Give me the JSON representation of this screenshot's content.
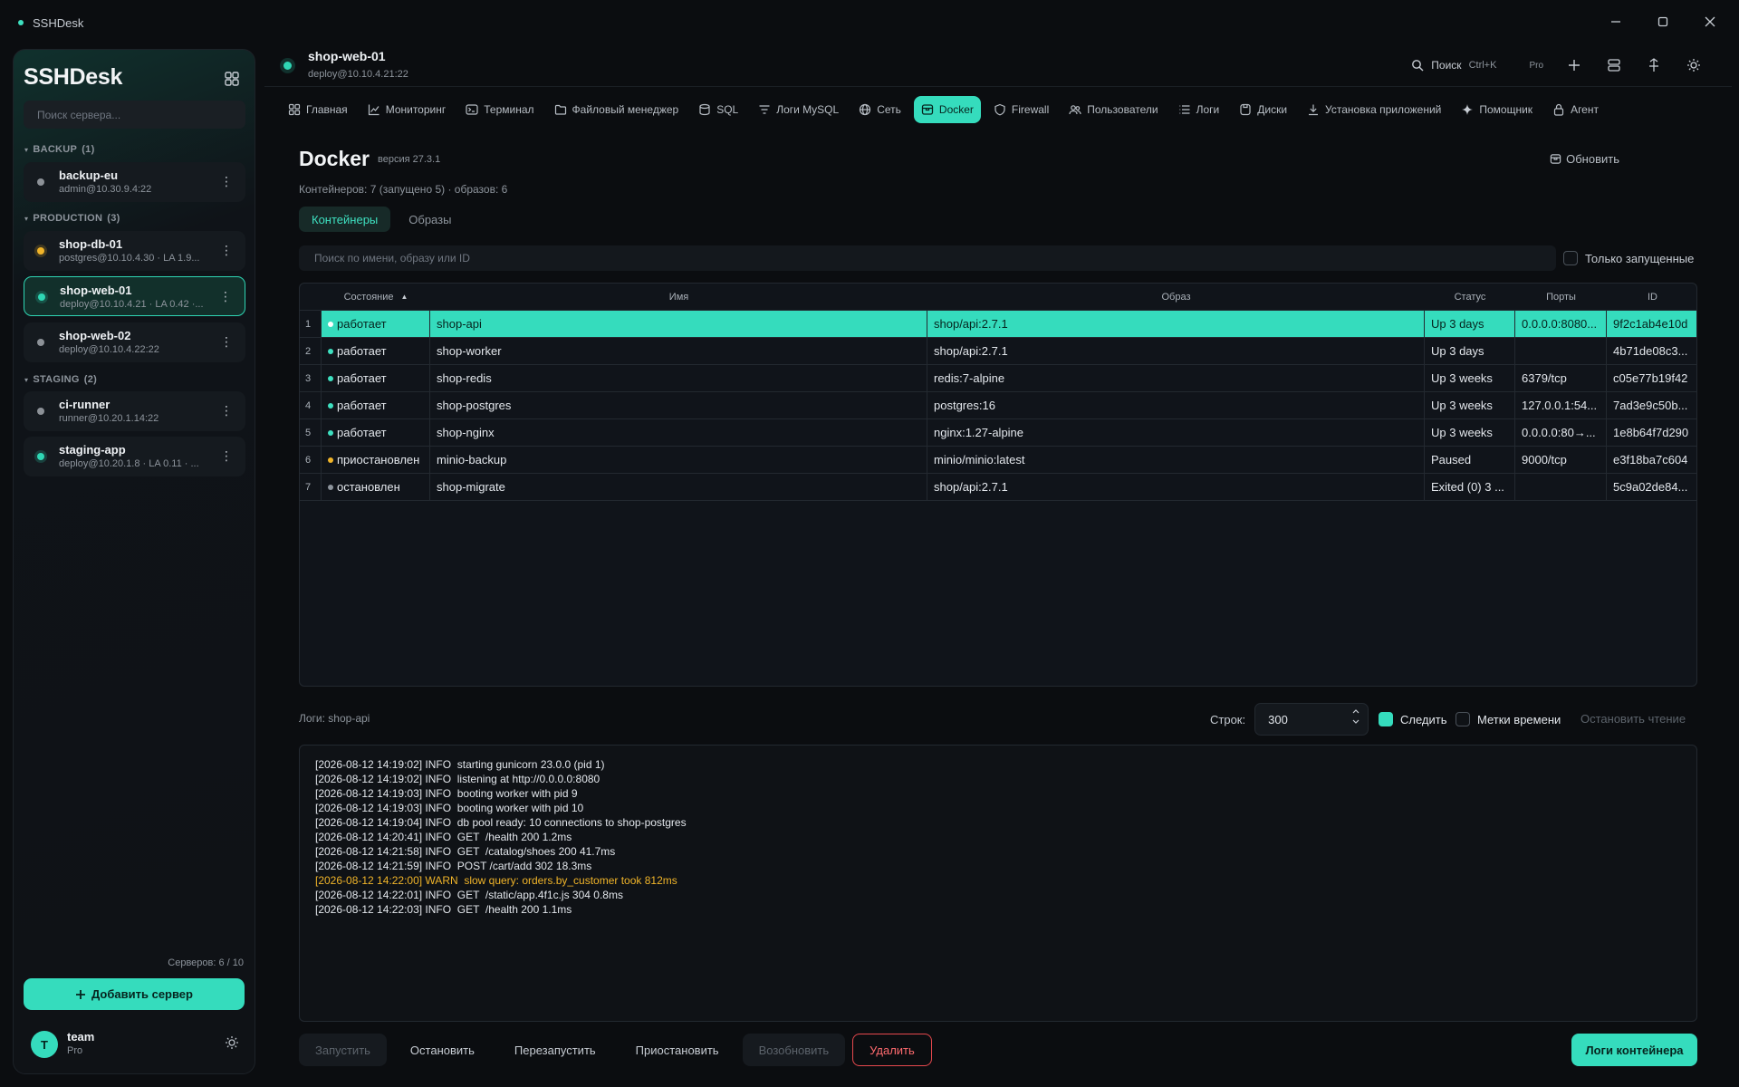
{
  "window": {
    "title": "SSHDesk"
  },
  "sidebar": {
    "brand": "SSHDesk",
    "search_placeholder": "Поиск сервера...",
    "groups": [
      {
        "label": "BACKUP",
        "count": "(1)"
      },
      {
        "label": "PRODUCTION",
        "count": "(3)"
      },
      {
        "label": "STAGING",
        "count": "(2)"
      }
    ],
    "servers": [
      {
        "name": "backup-eu",
        "sub": "admin@10.30.9.4:22",
        "status": "gray"
      },
      {
        "name": "shop-db-01",
        "sub": "postgres@10.10.4.30 · LA 1.9...",
        "status": "yellow"
      },
      {
        "name": "shop-web-01",
        "sub": "deploy@10.10.4.21 · LA 0.42 ·...",
        "status": "green"
      },
      {
        "name": "shop-web-02",
        "sub": "deploy@10.10.4.22:22",
        "status": "gray"
      },
      {
        "name": "ci-runner",
        "sub": "runner@10.20.1.14:22",
        "status": "gray"
      },
      {
        "name": "staging-app",
        "sub": "deploy@10.20.1.8 · LA 0.11 · ...",
        "status": "green"
      }
    ],
    "server_count": "Серверов: 6 / 10",
    "add_button": "Добавить сервер",
    "user": {
      "initial": "T",
      "name": "team",
      "plan": "Pro"
    }
  },
  "header": {
    "title": "shop-web-01",
    "subtitle": "deploy@10.10.4.21:22",
    "search_label": "Поиск",
    "shortcut": "Ctrl+K",
    "plan": "Pro"
  },
  "nav": {
    "tabs": [
      {
        "label": "Главная",
        "icon": "grid-icon"
      },
      {
        "label": "Мониторинг",
        "icon": "chart-icon"
      },
      {
        "label": "Терминал",
        "icon": "terminal-icon"
      },
      {
        "label": "Файловый менеджер",
        "icon": "folder-icon"
      },
      {
        "label": "SQL",
        "icon": "database-icon"
      },
      {
        "label": "Логи MySQL",
        "icon": "filter-icon"
      },
      {
        "label": "Сеть",
        "icon": "globe-icon"
      },
      {
        "label": "Docker",
        "icon": "container-icon",
        "active": true
      },
      {
        "label": "Firewall",
        "icon": "shield-icon"
      },
      {
        "label": "Пользователи",
        "icon": "users-icon"
      },
      {
        "label": "Логи",
        "icon": "list-icon"
      },
      {
        "label": "Диски",
        "icon": "disk-icon"
      },
      {
        "label": "Установка приложений",
        "icon": "download-icon"
      },
      {
        "label": "Помощник",
        "icon": "sparkle-icon"
      },
      {
        "label": "Агент",
        "icon": "lock-icon"
      }
    ]
  },
  "docker": {
    "title": "Docker",
    "version": "версия 27.3.1",
    "stats": "Контейнеров: 7 (запущено 5) · образов: 6",
    "refresh": "Обновить",
    "subtabs": [
      "Контейнеры",
      "Образы"
    ],
    "search_placeholder": "Поиск по имени, образу или ID",
    "only_running": "Только запущенные",
    "columns": {
      "state": "Состояние",
      "name": "Имя",
      "image": "Образ",
      "status": "Статус",
      "ports": "Порты",
      "id": "ID"
    },
    "rows": [
      {
        "n": "1",
        "state": "работает",
        "kind": "run",
        "name": "shop-api",
        "image": "shop/api:2.7.1",
        "status": "Up 3 days",
        "ports": "0.0.0.0:8080...",
        "id": "9f2c1ab4e10d"
      },
      {
        "n": "2",
        "state": "работает",
        "kind": "run",
        "name": "shop-worker",
        "image": "shop/api:2.7.1",
        "status": "Up 3 days",
        "ports": "",
        "id": "4b71de08c3..."
      },
      {
        "n": "3",
        "state": "работает",
        "kind": "run",
        "name": "shop-redis",
        "image": "redis:7-alpine",
        "status": "Up 3 weeks",
        "ports": "6379/tcp",
        "id": "c05e77b19f42"
      },
      {
        "n": "4",
        "state": "работает",
        "kind": "run",
        "name": "shop-postgres",
        "image": "postgres:16",
        "status": "Up 3 weeks",
        "ports": "127.0.0.1:54...",
        "id": "7ad3e9c50b..."
      },
      {
        "n": "5",
        "state": "работает",
        "kind": "run",
        "name": "shop-nginx",
        "image": "nginx:1.27-alpine",
        "status": "Up 3 weeks",
        "ports": "0.0.0.0:80→...",
        "id": "1e8b64f7d290"
      },
      {
        "n": "6",
        "state": "приостановлен",
        "kind": "pause",
        "name": "minio-backup",
        "image": "minio/minio:latest",
        "status": "Paused",
        "ports": "9000/tcp",
        "id": "e3f18ba7c604"
      },
      {
        "n": "7",
        "state": "остановлен",
        "kind": "stop",
        "name": "shop-migrate",
        "image": "shop/api:2.7.1",
        "status": "Exited (0) 3 ...",
        "ports": "",
        "id": "5c9a02de84..."
      }
    ]
  },
  "logs": {
    "label": "Логи: shop-api",
    "rows_label": "Строк:",
    "rows_value": "300",
    "follow": "Следить",
    "timestamps": "Метки времени",
    "stop_reading": "Остановить чтение",
    "lines": [
      {
        "text": "[2026-08-12 14:19:02] INFO  starting gunicorn 23.0.0 (pid 1)",
        "level": "info"
      },
      {
        "text": "[2026-08-12 14:19:02] INFO  listening at http://0.0.0.0:8080",
        "level": "info"
      },
      {
        "text": "[2026-08-12 14:19:03] INFO  booting worker with pid 9",
        "level": "info"
      },
      {
        "text": "[2026-08-12 14:19:03] INFO  booting worker with pid 10",
        "level": "info"
      },
      {
        "text": "[2026-08-12 14:19:04] INFO  db pool ready: 10 connections to shop-postgres",
        "level": "info"
      },
      {
        "text": "[2026-08-12 14:20:41] INFO  GET  /health 200 1.2ms",
        "level": "info"
      },
      {
        "text": "[2026-08-12 14:21:58] INFO  GET  /catalog/shoes 200 41.7ms",
        "level": "info"
      },
      {
        "text": "[2026-08-12 14:21:59] INFO  POST /cart/add 302 18.3ms",
        "level": "info"
      },
      {
        "text": "[2026-08-12 14:22:00] WARN  slow query: orders.by_customer took 812ms",
        "level": "warn"
      },
      {
        "text": "[2026-08-12 14:22:01] INFO  GET  /static/app.4f1c.js 304 0.8ms",
        "level": "info"
      },
      {
        "text": "[2026-08-12 14:22:03] INFO  GET  /health 200 1.1ms",
        "level": "info"
      }
    ]
  },
  "actions": {
    "start": "Запустить",
    "stop": "Остановить",
    "restart": "Перезапустить",
    "pause": "Приостановить",
    "resume": "Возобновить",
    "delete": "Удалить",
    "container_logs": "Логи контейнера"
  },
  "colors": {
    "accent": "#35dcbd",
    "warn": "#f0b429",
    "danger": "#e5484d",
    "background": "#0b0d10"
  }
}
